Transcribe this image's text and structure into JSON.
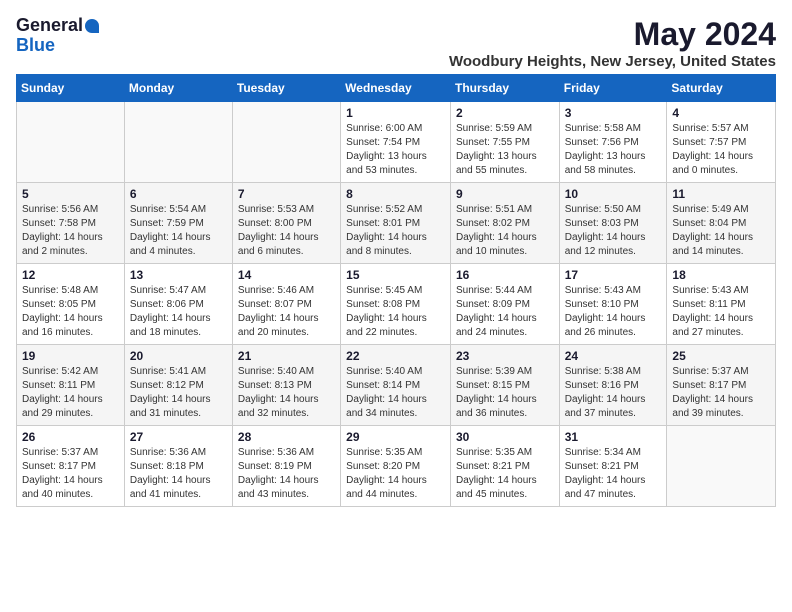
{
  "logo": {
    "general": "General",
    "blue": "Blue"
  },
  "title": "May 2024",
  "subtitle": "Woodbury Heights, New Jersey, United States",
  "headers": [
    "Sunday",
    "Monday",
    "Tuesday",
    "Wednesday",
    "Thursday",
    "Friday",
    "Saturday"
  ],
  "weeks": [
    [
      {
        "num": "",
        "info": ""
      },
      {
        "num": "",
        "info": ""
      },
      {
        "num": "",
        "info": ""
      },
      {
        "num": "1",
        "info": "Sunrise: 6:00 AM\nSunset: 7:54 PM\nDaylight: 13 hours\nand 53 minutes."
      },
      {
        "num": "2",
        "info": "Sunrise: 5:59 AM\nSunset: 7:55 PM\nDaylight: 13 hours\nand 55 minutes."
      },
      {
        "num": "3",
        "info": "Sunrise: 5:58 AM\nSunset: 7:56 PM\nDaylight: 13 hours\nand 58 minutes."
      },
      {
        "num": "4",
        "info": "Sunrise: 5:57 AM\nSunset: 7:57 PM\nDaylight: 14 hours\nand 0 minutes."
      }
    ],
    [
      {
        "num": "5",
        "info": "Sunrise: 5:56 AM\nSunset: 7:58 PM\nDaylight: 14 hours\nand 2 minutes."
      },
      {
        "num": "6",
        "info": "Sunrise: 5:54 AM\nSunset: 7:59 PM\nDaylight: 14 hours\nand 4 minutes."
      },
      {
        "num": "7",
        "info": "Sunrise: 5:53 AM\nSunset: 8:00 PM\nDaylight: 14 hours\nand 6 minutes."
      },
      {
        "num": "8",
        "info": "Sunrise: 5:52 AM\nSunset: 8:01 PM\nDaylight: 14 hours\nand 8 minutes."
      },
      {
        "num": "9",
        "info": "Sunrise: 5:51 AM\nSunset: 8:02 PM\nDaylight: 14 hours\nand 10 minutes."
      },
      {
        "num": "10",
        "info": "Sunrise: 5:50 AM\nSunset: 8:03 PM\nDaylight: 14 hours\nand 12 minutes."
      },
      {
        "num": "11",
        "info": "Sunrise: 5:49 AM\nSunset: 8:04 PM\nDaylight: 14 hours\nand 14 minutes."
      }
    ],
    [
      {
        "num": "12",
        "info": "Sunrise: 5:48 AM\nSunset: 8:05 PM\nDaylight: 14 hours\nand 16 minutes."
      },
      {
        "num": "13",
        "info": "Sunrise: 5:47 AM\nSunset: 8:06 PM\nDaylight: 14 hours\nand 18 minutes."
      },
      {
        "num": "14",
        "info": "Sunrise: 5:46 AM\nSunset: 8:07 PM\nDaylight: 14 hours\nand 20 minutes."
      },
      {
        "num": "15",
        "info": "Sunrise: 5:45 AM\nSunset: 8:08 PM\nDaylight: 14 hours\nand 22 minutes."
      },
      {
        "num": "16",
        "info": "Sunrise: 5:44 AM\nSunset: 8:09 PM\nDaylight: 14 hours\nand 24 minutes."
      },
      {
        "num": "17",
        "info": "Sunrise: 5:43 AM\nSunset: 8:10 PM\nDaylight: 14 hours\nand 26 minutes."
      },
      {
        "num": "18",
        "info": "Sunrise: 5:43 AM\nSunset: 8:11 PM\nDaylight: 14 hours\nand 27 minutes."
      }
    ],
    [
      {
        "num": "19",
        "info": "Sunrise: 5:42 AM\nSunset: 8:11 PM\nDaylight: 14 hours\nand 29 minutes."
      },
      {
        "num": "20",
        "info": "Sunrise: 5:41 AM\nSunset: 8:12 PM\nDaylight: 14 hours\nand 31 minutes."
      },
      {
        "num": "21",
        "info": "Sunrise: 5:40 AM\nSunset: 8:13 PM\nDaylight: 14 hours\nand 32 minutes."
      },
      {
        "num": "22",
        "info": "Sunrise: 5:40 AM\nSunset: 8:14 PM\nDaylight: 14 hours\nand 34 minutes."
      },
      {
        "num": "23",
        "info": "Sunrise: 5:39 AM\nSunset: 8:15 PM\nDaylight: 14 hours\nand 36 minutes."
      },
      {
        "num": "24",
        "info": "Sunrise: 5:38 AM\nSunset: 8:16 PM\nDaylight: 14 hours\nand 37 minutes."
      },
      {
        "num": "25",
        "info": "Sunrise: 5:37 AM\nSunset: 8:17 PM\nDaylight: 14 hours\nand 39 minutes."
      }
    ],
    [
      {
        "num": "26",
        "info": "Sunrise: 5:37 AM\nSunset: 8:17 PM\nDaylight: 14 hours\nand 40 minutes."
      },
      {
        "num": "27",
        "info": "Sunrise: 5:36 AM\nSunset: 8:18 PM\nDaylight: 14 hours\nand 41 minutes."
      },
      {
        "num": "28",
        "info": "Sunrise: 5:36 AM\nSunset: 8:19 PM\nDaylight: 14 hours\nand 43 minutes."
      },
      {
        "num": "29",
        "info": "Sunrise: 5:35 AM\nSunset: 8:20 PM\nDaylight: 14 hours\nand 44 minutes."
      },
      {
        "num": "30",
        "info": "Sunrise: 5:35 AM\nSunset: 8:21 PM\nDaylight: 14 hours\nand 45 minutes."
      },
      {
        "num": "31",
        "info": "Sunrise: 5:34 AM\nSunset: 8:21 PM\nDaylight: 14 hours\nand 47 minutes."
      },
      {
        "num": "",
        "info": ""
      }
    ]
  ]
}
